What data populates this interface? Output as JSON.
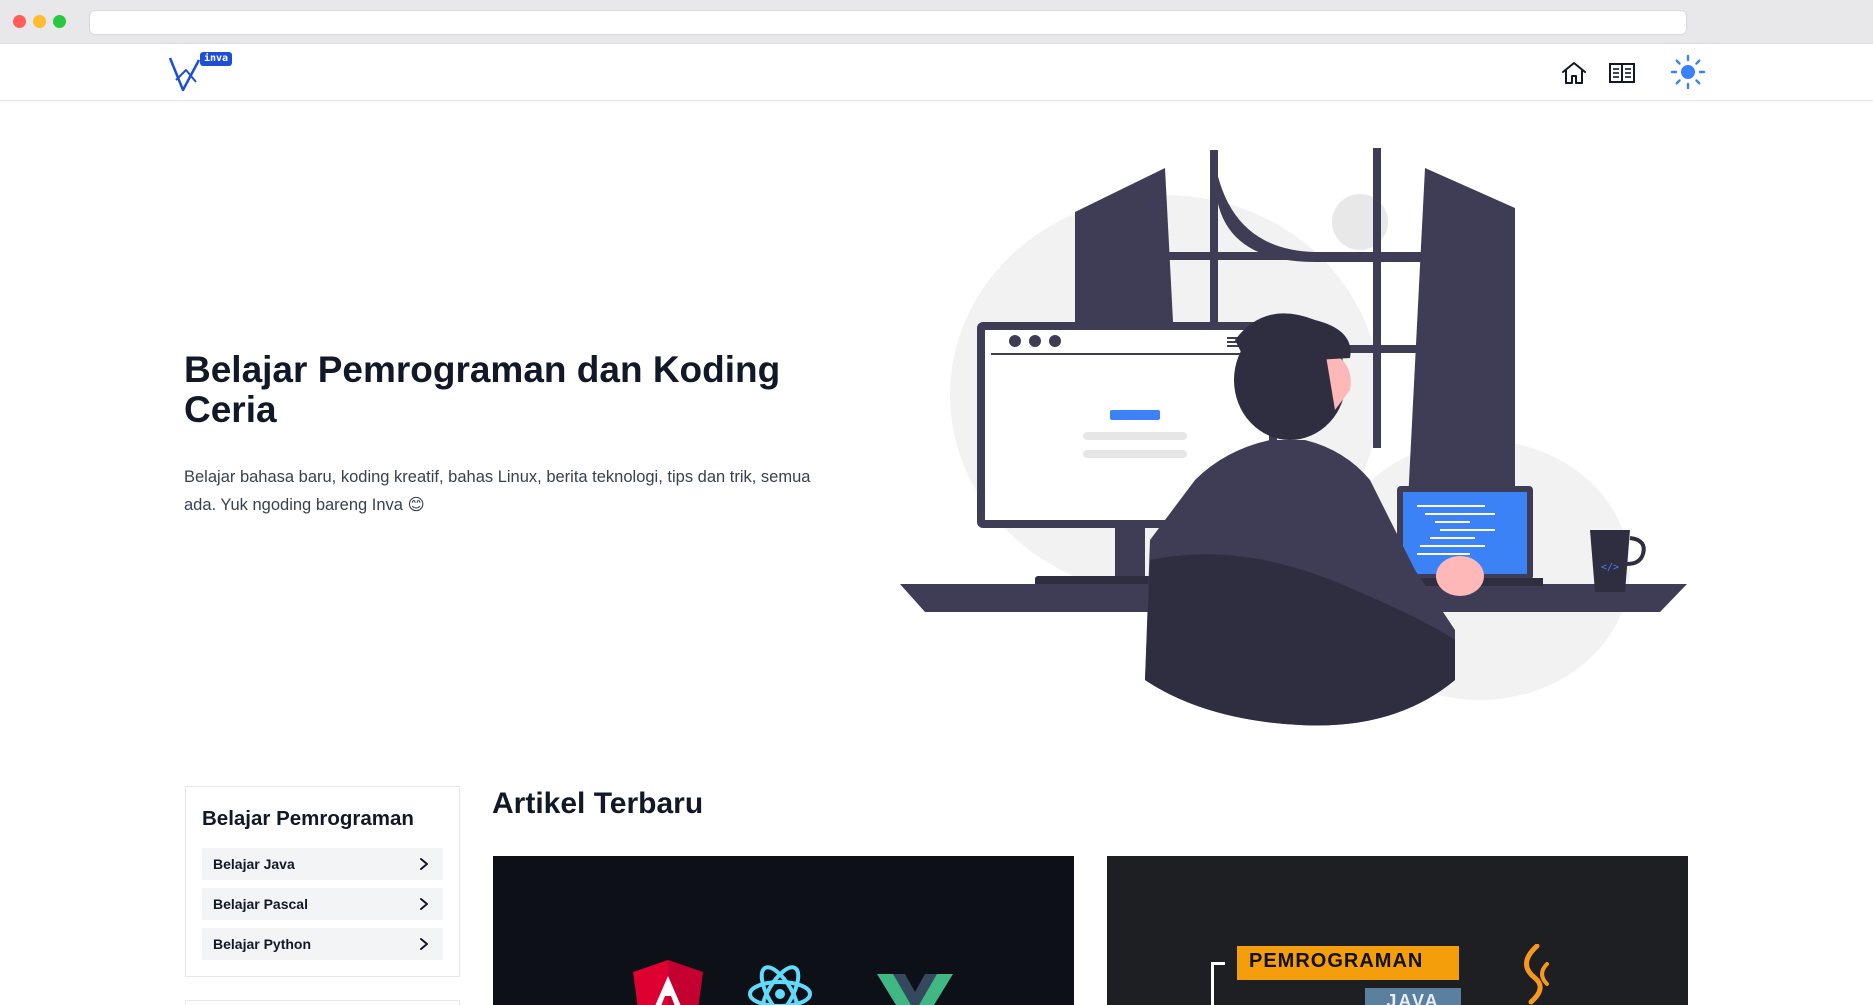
{
  "browser": {
    "url": ""
  },
  "header": {
    "logo_badge": "inva",
    "nav": [
      {
        "icon": "home-icon"
      },
      {
        "icon": "book-icon"
      },
      {
        "icon": "sun-icon"
      }
    ],
    "accent_color": "#3b82f6"
  },
  "hero": {
    "title": "Belajar Pemrograman dan Koding Ceria",
    "description": "Belajar bahasa baru, koding kreatif, bahas Linux, berita teknologi, tips dan trik, semua ada. Yuk ngoding bareng Inva 😊"
  },
  "sidebar": {
    "title": "Belajar Pemrograman",
    "items": [
      {
        "label": "Belajar Java"
      },
      {
        "label": "Belajar Pascal"
      },
      {
        "label": "Belajar Python"
      }
    ]
  },
  "articles": {
    "title": "Artikel Terbaru",
    "cards": [
      {
        "cover": "angular-react-vue-logos"
      },
      {
        "cover_text": "PEMROGRAMAN",
        "cover_subtext": "JAVA",
        "cover_icon": "java-icon"
      }
    ]
  }
}
